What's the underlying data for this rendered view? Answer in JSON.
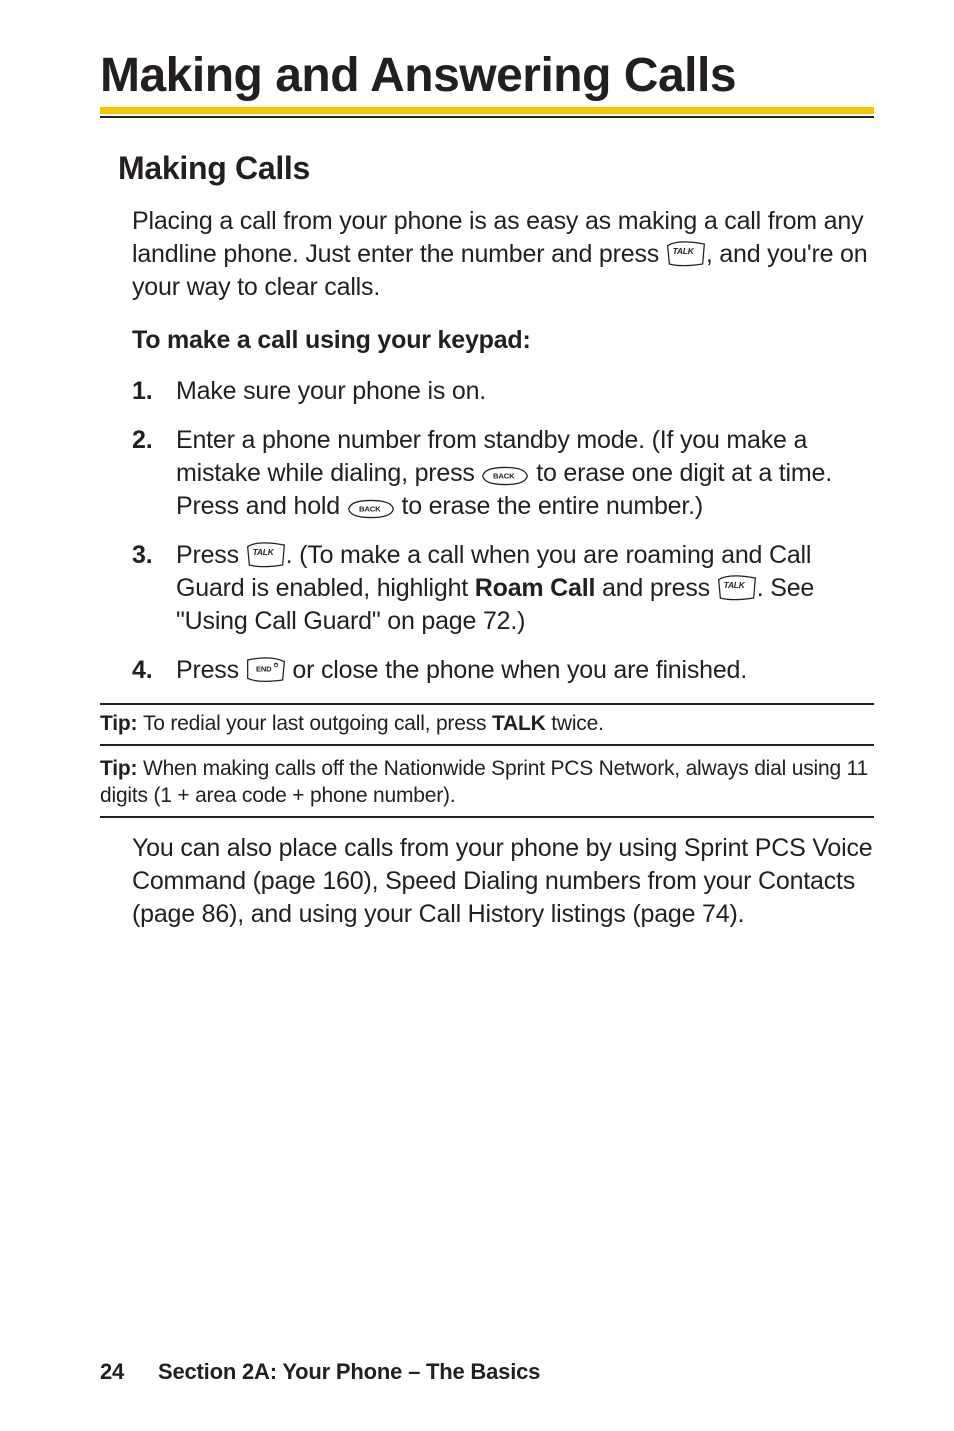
{
  "title": "Making and Answering Calls",
  "subhead": "Making Calls",
  "intro_pre": "Placing a call from your phone is as easy as making a call from any landline phone. Just enter the number and press ",
  "intro_post": ", and you're on your way to clear calls.",
  "how_to": "To make a call using your keypad:",
  "steps": {
    "s1": {
      "num": "1.",
      "text": "Make sure your phone is on."
    },
    "s2": {
      "num": "2.",
      "a": "Enter a phone number from standby mode. (If you make a mistake while dialing, press ",
      "b": " to erase one digit at a time. Press and hold ",
      "c": " to erase the entire number.)"
    },
    "s3": {
      "num": "3.",
      "a": "Press ",
      "b": ". (To make a call when you are roaming and Call Guard is enabled, highlight ",
      "roam": "Roam Call",
      "c": " and press ",
      "d": ". See \"Using Call Guard\" on page 72.)"
    },
    "s4": {
      "num": "4.",
      "a": "Press ",
      "b": " or close the phone when you are finished."
    }
  },
  "tip1": {
    "label": "Tip: ",
    "a": "To redial your last outgoing call, press ",
    "talk": "TALK",
    "b": " twice."
  },
  "tip2": {
    "label": "Tip: ",
    "text": "When making calls off the Nationwide Sprint PCS Network, always dial using 11 digits (1 + area code + phone number)."
  },
  "closing": "You can also place calls from your phone by using Sprint PCS Voice Command (page 160), Speed Dialing numbers from your Contacts (page 86), and using your Call History listings (page 74).",
  "footer": {
    "page": "24",
    "section": "Section 2A: Your Phone – The Basics"
  }
}
